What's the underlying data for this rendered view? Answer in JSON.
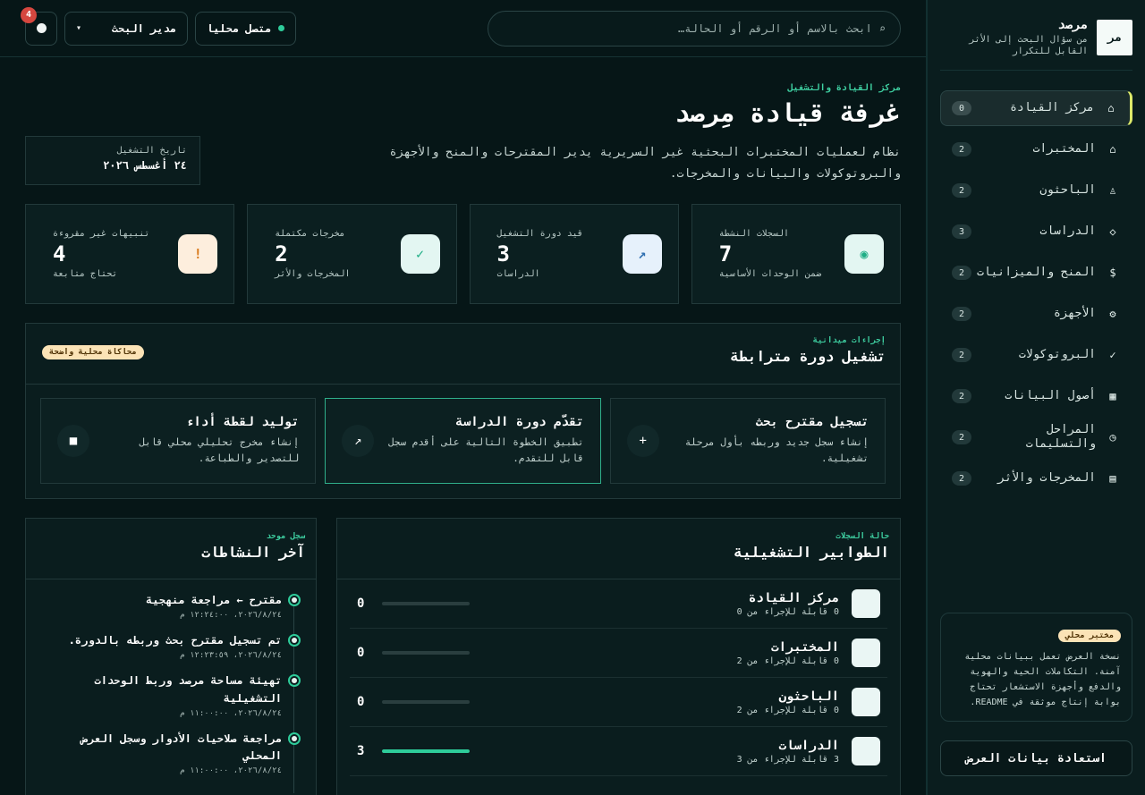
{
  "app": {
    "brand_logo": "مر",
    "brand_name": "مرصد",
    "brand_tagline": "من سؤال البحث إلى الأثر القابل للتكرار"
  },
  "sidebar": {
    "items": [
      {
        "label": "مركز القيادة",
        "icon": "grid-icon",
        "glyph": "⌂",
        "count": "0",
        "active": true
      },
      {
        "label": "المختبرات",
        "icon": "flask-icon",
        "glyph": "⌂",
        "count": "2",
        "active": false
      },
      {
        "label": "الباحثون",
        "icon": "people-icon",
        "glyph": "♙",
        "count": "2",
        "active": false
      },
      {
        "label": "الدراسات",
        "icon": "diamond-icon",
        "glyph": "◇",
        "count": "3",
        "active": false
      },
      {
        "label": "المنح والميزانيات",
        "icon": "dollar-icon",
        "glyph": "$",
        "count": "2",
        "active": false
      },
      {
        "label": "الأجهزة",
        "icon": "gear-icon",
        "glyph": "⚙",
        "count": "2",
        "active": false
      },
      {
        "label": "البروتوكولات",
        "icon": "check-icon",
        "glyph": "✓",
        "count": "2",
        "active": false
      },
      {
        "label": "أصول البيانات",
        "icon": "database-icon",
        "glyph": "▦",
        "count": "2",
        "active": false
      },
      {
        "label": "المراحل والتسليمات",
        "icon": "clock-icon",
        "glyph": "◷",
        "count": "2",
        "active": false
      },
      {
        "label": "المخرجات والأثر",
        "icon": "document-icon",
        "glyph": "▤",
        "count": "2",
        "active": false
      }
    ],
    "note_badge": "مختبر محلي",
    "note_text": "نسخة العرض تعمل ببيانات محلية آمنة. التكاملات الحية والهوية والدفع وأجهزة الاستشعار تحتاج بوابة إنتاج موثقة في README.",
    "restore_button": "استعادة بيانات العرض"
  },
  "topbar": {
    "search_placeholder": "ابحث بالاسم أو الرقم أو الحالة…",
    "connection_label": "متصل محليا",
    "role_label": "مدير البحث",
    "notifications_count": "4"
  },
  "hero": {
    "eyebrow": "مركز القيادة والتشغيل",
    "title": "غرفة قيادة مِرصد",
    "description": "نظام لعمليات المختبرات البحثية غير السريرية يدير المقترحات والمنح والأجهزة والبروتوكولات والبيانات والمخرجات.",
    "date_label": "تاريخ التشغيل",
    "date_value": "٢٤ أغسطس ٢٠٢٦"
  },
  "stats": [
    {
      "label": "السجلات النشطة",
      "value": "7",
      "sub": "ضمن الوحدات الأساسية",
      "icon": "target-icon",
      "glyph": "◉",
      "bg": "#e3f6f2",
      "fg": "#1fae86"
    },
    {
      "label": "قيد دورة التشغيل",
      "value": "3",
      "sub": "الدراسات",
      "icon": "trend-icon",
      "glyph": "↗",
      "bg": "#e6f1fb",
      "fg": "#2f6fb0"
    },
    {
      "label": "مخرجات مكتملة",
      "value": "2",
      "sub": "المخرجات والأثر",
      "icon": "check-icon",
      "glyph": "✓",
      "bg": "#e3f6f2",
      "fg": "#1fae86"
    },
    {
      "label": "تنبيهات غير مقروءة",
      "value": "4",
      "sub": "تحتاج متابعة",
      "icon": "alert-icon",
      "glyph": "!",
      "bg": "#fdeedd",
      "fg": "#d97a1c"
    }
  ],
  "flow": {
    "eyebrow": "إجراءات ميدانية",
    "title": "تشغيل دورة مترابطة",
    "badge": "محاكاة محلية واضحة",
    "cards": [
      {
        "title": "تسجيل مقترح بحث",
        "desc": "إنشاء سجل جديد وربطه بأول مرحلة تشغيلية.",
        "icon": "plus-icon",
        "glyph": "+",
        "highlight": false
      },
      {
        "title": "تقدّم دورة الدراسة",
        "desc": "تطبيق الخطوة التالية على أقدم سجل قابل للتقدم.",
        "icon": "arrow-icon",
        "glyph": "↗",
        "highlight": true
      },
      {
        "title": "توليد لقطة أداء",
        "desc": "إنشاء مخرج تحليلي محلي قابل للتصدير والطباعة.",
        "icon": "square-icon",
        "glyph": "■",
        "highlight": false
      }
    ]
  },
  "queues": {
    "eyebrow": "حالة السجلات",
    "title": "الطوابير التشغيلية",
    "rows": [
      {
        "name": "مركز القيادة",
        "sub": "0 قابلة للإجراء من 0",
        "count": "0",
        "ratio": 0
      },
      {
        "name": "المختبرات",
        "sub": "0 قابلة للإجراء من 2",
        "count": "0",
        "ratio": 0
      },
      {
        "name": "الباحثون",
        "sub": "0 قابلة للإجراء من 2",
        "count": "0",
        "ratio": 0
      },
      {
        "name": "الدراسات",
        "sub": "3 قابلة للإجراء من 3",
        "count": "3",
        "ratio": 1
      }
    ]
  },
  "activity": {
    "eyebrow": "سجل موحد",
    "title": "آخر النشاطات",
    "items": [
      {
        "title": "مقترح ← مراجعة منهجية",
        "time": "٢٠٢٦/٨/٢٤، ١٢:٢٤:٠٠ م"
      },
      {
        "title": "تم تسجيل مقترح بحث وربطه بالدورة.",
        "time": "٢٠٢٦/٨/٢٤، ١٢:٢٣:٥٩ م"
      },
      {
        "title": "تهيئة مساحة مرصد وربط الوحدات التشغيلية",
        "time": "٢٠٢٦/٨/٢٤، ١١:٠٠:٠٠ م"
      },
      {
        "title": "مراجعة صلاحيات الأدوار وسجل العرض المحلي",
        "time": "٢٠٢٦/٨/٢٤، ١١:٠٠:٠٠ م"
      }
    ]
  }
}
